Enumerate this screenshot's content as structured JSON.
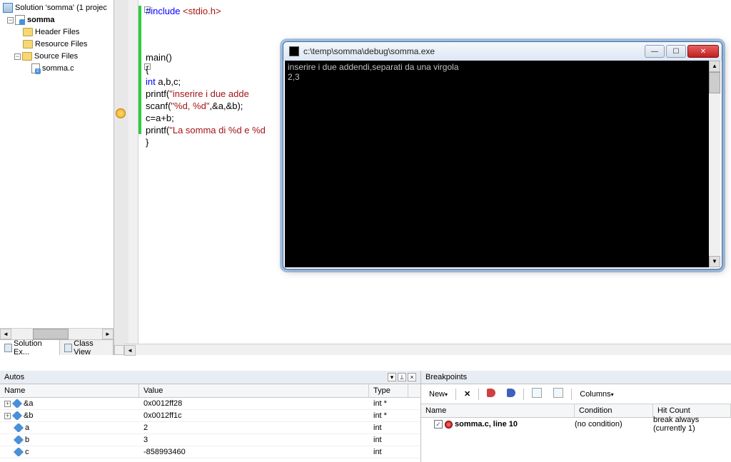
{
  "tree": {
    "solution": "Solution 'somma' (1 projec",
    "project": "somma",
    "folders": [
      "Header Files",
      "Resource Files",
      "Source Files"
    ],
    "file": "somma.c"
  },
  "explorer_tabs": {
    "active": "Solution Ex...",
    "other": "Class View"
  },
  "code": {
    "l1a": "#include ",
    "l1b": "<stdio.h>",
    "l5": "main()",
    "l6": "{",
    "l7a": "int",
    "l7b": " a,b,c;",
    "l8a": "printf(",
    "l8b": "\"inserire i due adde",
    "l9a": "scanf(",
    "l9b": "\"%d, %d\"",
    "l9c": ",&a,&b);",
    "l10": "c=a+b;",
    "l11a": "printf(",
    "l11b": "\"La somma di %d e %d",
    "l12": "}"
  },
  "console": {
    "title": "c:\\temp\\somma\\debug\\somma.exe",
    "line1": "inserire i due addendi,separati da una virgola",
    "line2": "2,3"
  },
  "autos": {
    "title": "Autos",
    "cols": {
      "name": "Name",
      "value": "Value",
      "type": "Type"
    },
    "rows": [
      {
        "exp": true,
        "name": "&a",
        "value": "0x0012ff28",
        "type": "int *"
      },
      {
        "exp": true,
        "name": "&b",
        "value": "0x0012ff1c",
        "type": "int *"
      },
      {
        "exp": false,
        "name": "a",
        "value": "2",
        "type": "int"
      },
      {
        "exp": false,
        "name": "b",
        "value": "3",
        "type": "int"
      },
      {
        "exp": false,
        "name": "c",
        "value": "-858993460",
        "type": "int"
      }
    ]
  },
  "breakpoints": {
    "title": "Breakpoints",
    "toolbar": {
      "new": "New",
      "columns": "Columns"
    },
    "cols": {
      "name": "Name",
      "cond": "Condition",
      "hit": "Hit Count"
    },
    "row": {
      "name": "somma.c, line 10",
      "cond": "(no condition)",
      "hit": "break always (currently 1)"
    }
  }
}
